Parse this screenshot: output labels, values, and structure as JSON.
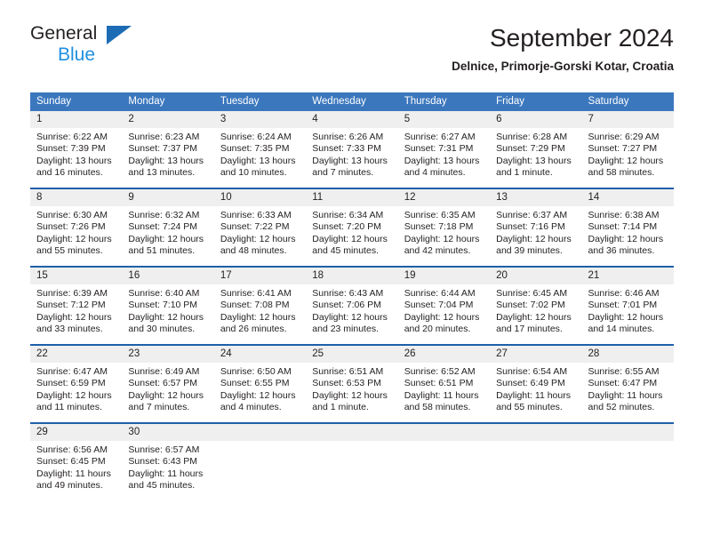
{
  "brand": {
    "name_top": "General",
    "name_bottom": "Blue",
    "triangle_color": "#1c6cb5",
    "blue_text_color": "#1f8fe0"
  },
  "header": {
    "title": "September 2024",
    "subtitle": "Delnice, Primorje-Gorski Kotar, Croatia"
  },
  "theme": {
    "header_blue": "#3b77bd",
    "week_divider_blue": "#1f5fa9",
    "daynum_band": "#efefef",
    "text": "#231f20"
  },
  "calendar": {
    "weekday_headers": [
      "Sunday",
      "Monday",
      "Tuesday",
      "Wednesday",
      "Thursday",
      "Friday",
      "Saturday"
    ],
    "weeks": [
      [
        {
          "day": "1",
          "sunrise": "Sunrise: 6:22 AM",
          "sunset": "Sunset: 7:39 PM",
          "daylight_1": "Daylight: 13 hours",
          "daylight_2": "and 16 minutes."
        },
        {
          "day": "2",
          "sunrise": "Sunrise: 6:23 AM",
          "sunset": "Sunset: 7:37 PM",
          "daylight_1": "Daylight: 13 hours",
          "daylight_2": "and 13 minutes."
        },
        {
          "day": "3",
          "sunrise": "Sunrise: 6:24 AM",
          "sunset": "Sunset: 7:35 PM",
          "daylight_1": "Daylight: 13 hours",
          "daylight_2": "and 10 minutes."
        },
        {
          "day": "4",
          "sunrise": "Sunrise: 6:26 AM",
          "sunset": "Sunset: 7:33 PM",
          "daylight_1": "Daylight: 13 hours",
          "daylight_2": "and 7 minutes."
        },
        {
          "day": "5",
          "sunrise": "Sunrise: 6:27 AM",
          "sunset": "Sunset: 7:31 PM",
          "daylight_1": "Daylight: 13 hours",
          "daylight_2": "and 4 minutes."
        },
        {
          "day": "6",
          "sunrise": "Sunrise: 6:28 AM",
          "sunset": "Sunset: 7:29 PM",
          "daylight_1": "Daylight: 13 hours",
          "daylight_2": "and 1 minute."
        },
        {
          "day": "7",
          "sunrise": "Sunrise: 6:29 AM",
          "sunset": "Sunset: 7:27 PM",
          "daylight_1": "Daylight: 12 hours",
          "daylight_2": "and 58 minutes."
        }
      ],
      [
        {
          "day": "8",
          "sunrise": "Sunrise: 6:30 AM",
          "sunset": "Sunset: 7:26 PM",
          "daylight_1": "Daylight: 12 hours",
          "daylight_2": "and 55 minutes."
        },
        {
          "day": "9",
          "sunrise": "Sunrise: 6:32 AM",
          "sunset": "Sunset: 7:24 PM",
          "daylight_1": "Daylight: 12 hours",
          "daylight_2": "and 51 minutes."
        },
        {
          "day": "10",
          "sunrise": "Sunrise: 6:33 AM",
          "sunset": "Sunset: 7:22 PM",
          "daylight_1": "Daylight: 12 hours",
          "daylight_2": "and 48 minutes."
        },
        {
          "day": "11",
          "sunrise": "Sunrise: 6:34 AM",
          "sunset": "Sunset: 7:20 PM",
          "daylight_1": "Daylight: 12 hours",
          "daylight_2": "and 45 minutes."
        },
        {
          "day": "12",
          "sunrise": "Sunrise: 6:35 AM",
          "sunset": "Sunset: 7:18 PM",
          "daylight_1": "Daylight: 12 hours",
          "daylight_2": "and 42 minutes."
        },
        {
          "day": "13",
          "sunrise": "Sunrise: 6:37 AM",
          "sunset": "Sunset: 7:16 PM",
          "daylight_1": "Daylight: 12 hours",
          "daylight_2": "and 39 minutes."
        },
        {
          "day": "14",
          "sunrise": "Sunrise: 6:38 AM",
          "sunset": "Sunset: 7:14 PM",
          "daylight_1": "Daylight: 12 hours",
          "daylight_2": "and 36 minutes."
        }
      ],
      [
        {
          "day": "15",
          "sunrise": "Sunrise: 6:39 AM",
          "sunset": "Sunset: 7:12 PM",
          "daylight_1": "Daylight: 12 hours",
          "daylight_2": "and 33 minutes."
        },
        {
          "day": "16",
          "sunrise": "Sunrise: 6:40 AM",
          "sunset": "Sunset: 7:10 PM",
          "daylight_1": "Daylight: 12 hours",
          "daylight_2": "and 30 minutes."
        },
        {
          "day": "17",
          "sunrise": "Sunrise: 6:41 AM",
          "sunset": "Sunset: 7:08 PM",
          "daylight_1": "Daylight: 12 hours",
          "daylight_2": "and 26 minutes."
        },
        {
          "day": "18",
          "sunrise": "Sunrise: 6:43 AM",
          "sunset": "Sunset: 7:06 PM",
          "daylight_1": "Daylight: 12 hours",
          "daylight_2": "and 23 minutes."
        },
        {
          "day": "19",
          "sunrise": "Sunrise: 6:44 AM",
          "sunset": "Sunset: 7:04 PM",
          "daylight_1": "Daylight: 12 hours",
          "daylight_2": "and 20 minutes."
        },
        {
          "day": "20",
          "sunrise": "Sunrise: 6:45 AM",
          "sunset": "Sunset: 7:02 PM",
          "daylight_1": "Daylight: 12 hours",
          "daylight_2": "and 17 minutes."
        },
        {
          "day": "21",
          "sunrise": "Sunrise: 6:46 AM",
          "sunset": "Sunset: 7:01 PM",
          "daylight_1": "Daylight: 12 hours",
          "daylight_2": "and 14 minutes."
        }
      ],
      [
        {
          "day": "22",
          "sunrise": "Sunrise: 6:47 AM",
          "sunset": "Sunset: 6:59 PM",
          "daylight_1": "Daylight: 12 hours",
          "daylight_2": "and 11 minutes."
        },
        {
          "day": "23",
          "sunrise": "Sunrise: 6:49 AM",
          "sunset": "Sunset: 6:57 PM",
          "daylight_1": "Daylight: 12 hours",
          "daylight_2": "and 7 minutes."
        },
        {
          "day": "24",
          "sunrise": "Sunrise: 6:50 AM",
          "sunset": "Sunset: 6:55 PM",
          "daylight_1": "Daylight: 12 hours",
          "daylight_2": "and 4 minutes."
        },
        {
          "day": "25",
          "sunrise": "Sunrise: 6:51 AM",
          "sunset": "Sunset: 6:53 PM",
          "daylight_1": "Daylight: 12 hours",
          "daylight_2": "and 1 minute."
        },
        {
          "day": "26",
          "sunrise": "Sunrise: 6:52 AM",
          "sunset": "Sunset: 6:51 PM",
          "daylight_1": "Daylight: 11 hours",
          "daylight_2": "and 58 minutes."
        },
        {
          "day": "27",
          "sunrise": "Sunrise: 6:54 AM",
          "sunset": "Sunset: 6:49 PM",
          "daylight_1": "Daylight: 11 hours",
          "daylight_2": "and 55 minutes."
        },
        {
          "day": "28",
          "sunrise": "Sunrise: 6:55 AM",
          "sunset": "Sunset: 6:47 PM",
          "daylight_1": "Daylight: 11 hours",
          "daylight_2": "and 52 minutes."
        }
      ],
      [
        {
          "day": "29",
          "sunrise": "Sunrise: 6:56 AM",
          "sunset": "Sunset: 6:45 PM",
          "daylight_1": "Daylight: 11 hours",
          "daylight_2": "and 49 minutes."
        },
        {
          "day": "30",
          "sunrise": "Sunrise: 6:57 AM",
          "sunset": "Sunset: 6:43 PM",
          "daylight_1": "Daylight: 11 hours",
          "daylight_2": "and 45 minutes."
        },
        {
          "day": "",
          "sunrise": "",
          "sunset": "",
          "daylight_1": "",
          "daylight_2": ""
        },
        {
          "day": "",
          "sunrise": "",
          "sunset": "",
          "daylight_1": "",
          "daylight_2": ""
        },
        {
          "day": "",
          "sunrise": "",
          "sunset": "",
          "daylight_1": "",
          "daylight_2": ""
        },
        {
          "day": "",
          "sunrise": "",
          "sunset": "",
          "daylight_1": "",
          "daylight_2": ""
        },
        {
          "day": "",
          "sunrise": "",
          "sunset": "",
          "daylight_1": "",
          "daylight_2": ""
        }
      ]
    ]
  }
}
